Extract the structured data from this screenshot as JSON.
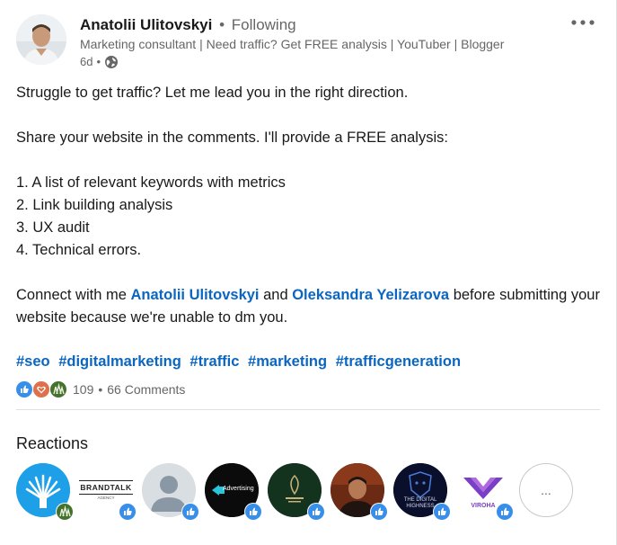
{
  "author": {
    "name": "Anatolii Ulitovskyi",
    "separator": "•",
    "follow_state": "Following",
    "headline": "Marketing consultant | Need traffic? Get FREE analysis | YouTuber | Blogger",
    "time_ago": "6d",
    "time_sep": "•",
    "visibility_icon": "globe-icon"
  },
  "post": {
    "intro": "Struggle to get traffic? Let me lead you in the right direction.",
    "offer": "Share your website in the comments. I'll provide a FREE analysis:",
    "list": [
      "1. A list of relevant keywords with metrics",
      "2. Link building analysis",
      "3. UX audit",
      "4. Technical errors."
    ],
    "connect_prefix": "Connect with me ",
    "mention_1": "Anatolii Ulitovskyi",
    "connect_middle": " and ",
    "mention_2": "Oleksandra Yelizarova",
    "connect_suffix": " before submitting your website because we're unable to dm you.",
    "hashtags": [
      "#seo",
      "#digitalmarketing",
      "#traffic",
      "#marketing",
      "#trafficgeneration"
    ]
  },
  "social": {
    "reaction_icons": [
      "like-icon",
      "love-icon",
      "insightful-icon"
    ],
    "reaction_count": "109",
    "separator": "•",
    "comments": "66 Comments"
  },
  "reactions": {
    "title": "Reactions",
    "reactors": [
      {
        "name": "reactor-1",
        "badge": "insightful-icon"
      },
      {
        "name": "reactor-brandtalk",
        "logo_text": "BRANDTALK",
        "logo_sub": "AGENCY",
        "badge": "like-icon"
      },
      {
        "name": "reactor-default-avatar",
        "badge": "like-icon"
      },
      {
        "name": "reactor-advertising",
        "logo_text": "Advertising",
        "badge": "like-icon"
      },
      {
        "name": "reactor-green-logo",
        "badge": "like-icon"
      },
      {
        "name": "reactor-6",
        "badge": "like-icon"
      },
      {
        "name": "reactor-digital-highness",
        "logo_text": "THE DIGITAL",
        "logo_sub": "HIGHNESS",
        "badge": "like-icon"
      },
      {
        "name": "reactor-viroha",
        "logo_text": "VIROHA",
        "badge": "like-icon"
      }
    ],
    "more_label": "..."
  },
  "colors": {
    "link": "#0a66c2",
    "muted": "#666666",
    "like": "#378fe9",
    "love": "#df704d",
    "insightful": "#44712e"
  }
}
